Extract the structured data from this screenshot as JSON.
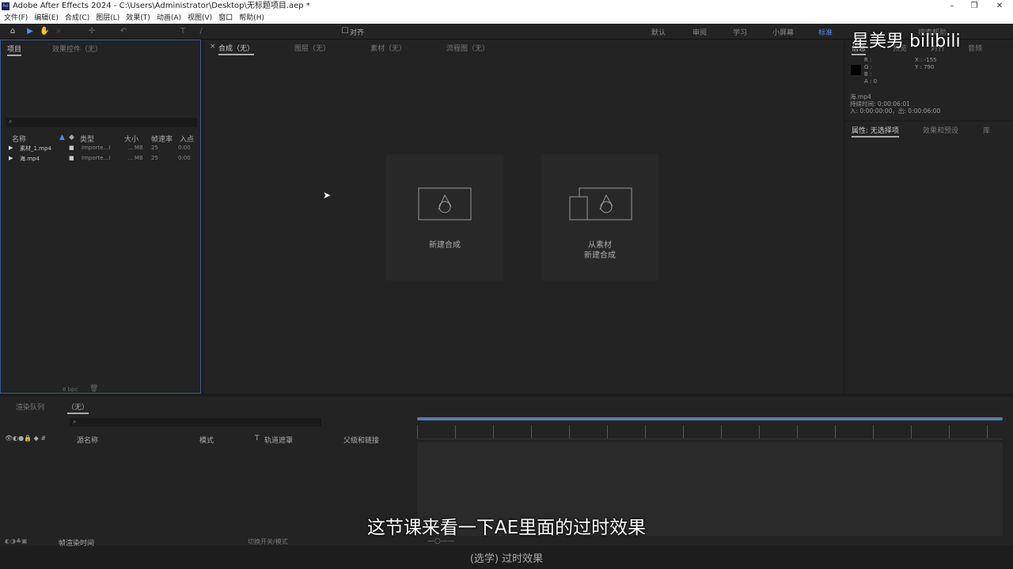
{
  "app": {
    "title": "Adobe After Effects 2024 - C:\\Users\\Administrator\\Desktop\\无标题项目.aep *",
    "icon": "Ae"
  },
  "window": {
    "minimize": "–",
    "restore": "❐",
    "close": "✕"
  },
  "menu": [
    "文件(F)",
    "编辑(E)",
    "合成(C)",
    "图层(L)",
    "效果(T)",
    "动画(A)",
    "视图(V)",
    "窗口",
    "帮助(H)"
  ],
  "toolbar": {
    "snap_label": "对齐",
    "workspaces": [
      "默认",
      "审阅",
      "学习",
      "小屏幕",
      "标准"
    ],
    "active_workspace": "标准",
    "search_help": "搜索帮助"
  },
  "project": {
    "tabs": [
      "项目",
      "效果控件（无）"
    ],
    "columns": [
      "名称",
      "类型",
      "大小",
      "帧速率",
      "入点"
    ],
    "items": [
      {
        "name": "素材_1.mp4",
        "type": "Importe...I",
        "size": "... MB",
        "fps": "25",
        "in": "0:00"
      },
      {
        "name": "海.mp4",
        "type": "Importe...I",
        "size": "... MB",
        "fps": "25",
        "in": "0:00"
      }
    ],
    "bpc": "8 bpc"
  },
  "comp": {
    "tabs": [
      "合成（无）",
      "图层（无）",
      "素材（无）",
      "流程图（无）"
    ],
    "new_comp": "新建合成",
    "from_footage_1": "从素材",
    "from_footage_2": "新建合成"
  },
  "info": {
    "tabs": [
      "信息",
      "预览",
      "对齐",
      "音频"
    ],
    "r": "R :",
    "g": "G :",
    "b": "B :",
    "a": "A : 0",
    "x": "X : -155",
    "y": "Y : 790",
    "file": "海.mp4",
    "duration": "持续时间: 0:00:06:01",
    "inout": "入: 0:00:00:00，出: 0:00:06:00"
  },
  "properties": {
    "tabs": [
      "属性: 无选择项",
      "效果和预设",
      "库"
    ]
  },
  "timeline": {
    "tabs": [
      "渲染队列",
      "（无）"
    ],
    "columns": [
      "源名称",
      "模式",
      "T",
      "轨道遮罩",
      "父级和链接"
    ],
    "footer_left": "帧渲染时间",
    "footer_mid": "切换开关/模式"
  },
  "overlay": {
    "subtitle": "这节课来看一下AE里面的过时效果",
    "chapter": "(选学) 过时效果",
    "watermark": "星美男  bilibili"
  },
  "colors": {
    "accent": "#4a8cff",
    "panel": "#232323",
    "bg": "#1d1d1d"
  }
}
